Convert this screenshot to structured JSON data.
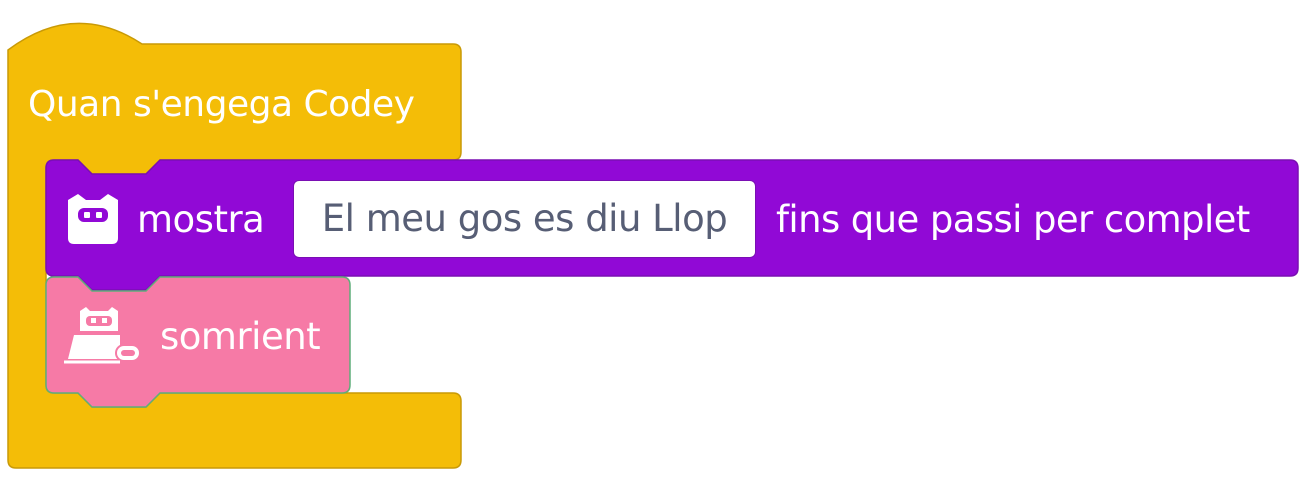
{
  "colors": {
    "events": "#f4bd07",
    "events_border": "#c99a06",
    "looks": "#9109d6",
    "looks_border": "#7a0fb3",
    "motion": "#f67aa6",
    "motion_border": "#5fae7a",
    "input_text": "#575e75"
  },
  "hat_block": {
    "label": "Quan s'engega Codey"
  },
  "show_block": {
    "icon": "codey-face-icon",
    "label": "mostra",
    "text_value": "El meu gos es diu Llop",
    "suffix": "fins que passi per complet"
  },
  "smile_block": {
    "icon": "codey-robot-icon",
    "label": "somrient"
  }
}
